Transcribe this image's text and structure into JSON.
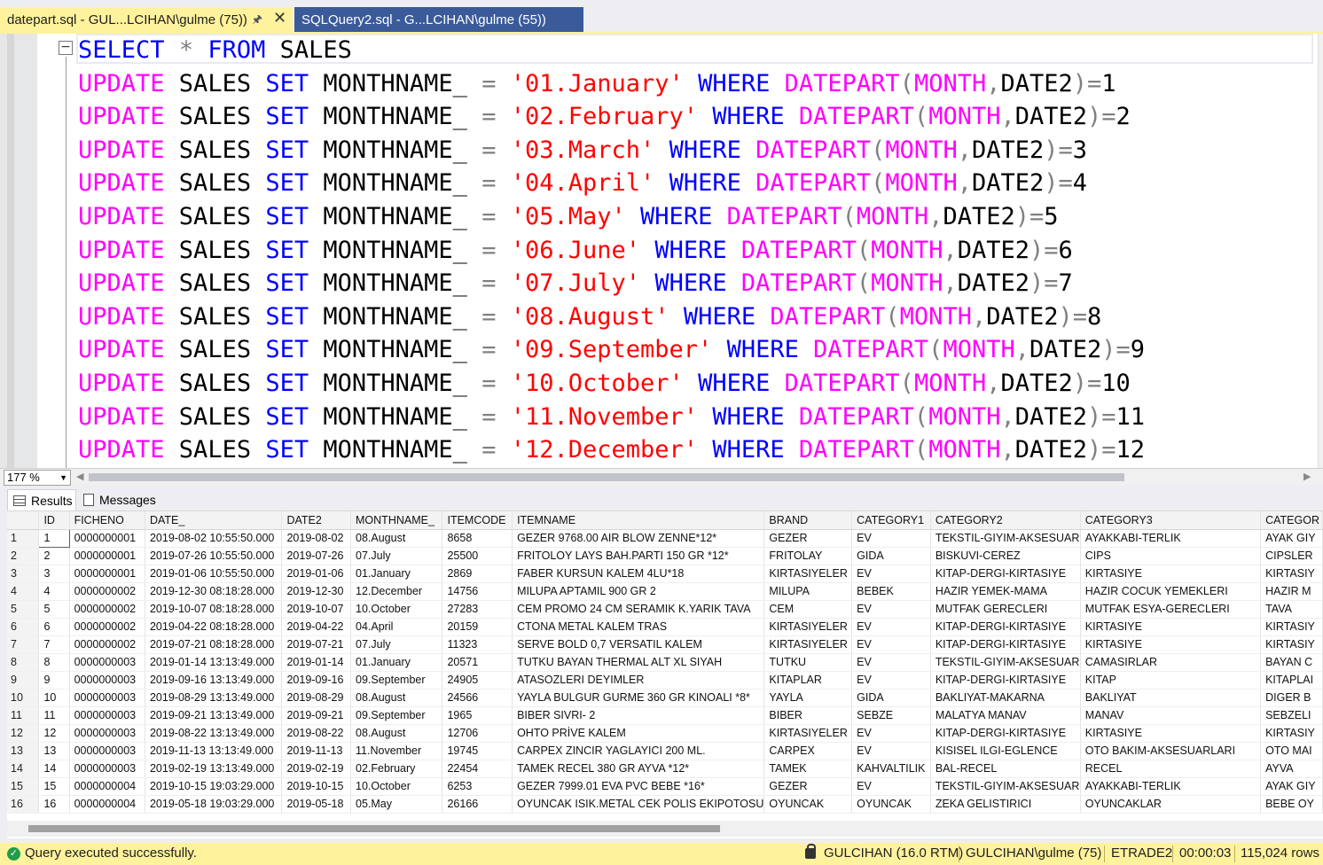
{
  "tabs": {
    "active_label": "datepart.sql - GUL...LCIHAN\\gulme (75))",
    "inactive_label": "SQLQuery2.sql - G...LCIHAN\\gulme (55))"
  },
  "editor": {
    "lines": [
      [
        {
          "t": "SELECT",
          "c": "kw"
        },
        {
          "t": " ",
          "c": "id"
        },
        {
          "t": "*",
          "c": "op"
        },
        {
          "t": " ",
          "c": "id"
        },
        {
          "t": "FROM",
          "c": "kw"
        },
        {
          "t": " SALES",
          "c": "id"
        }
      ],
      [
        {
          "t": "UPDATE",
          "c": "fn"
        },
        {
          "t": " SALES ",
          "c": "id"
        },
        {
          "t": "SET",
          "c": "kw"
        },
        {
          "t": " MONTHNAME_ ",
          "c": "id"
        },
        {
          "t": "=",
          "c": "op"
        },
        {
          "t": " ",
          "c": "id"
        },
        {
          "t": "'01.January'",
          "c": "str"
        },
        {
          "t": " ",
          "c": "id"
        },
        {
          "t": "WHERE",
          "c": "kw"
        },
        {
          "t": " ",
          "c": "id"
        },
        {
          "t": "DATEPART",
          "c": "fn"
        },
        {
          "t": "(",
          "c": "op"
        },
        {
          "t": "MONTH",
          "c": "fn"
        },
        {
          "t": ",",
          "c": "op"
        },
        {
          "t": "DATE2",
          "c": "id"
        },
        {
          "t": ")",
          "c": "op"
        },
        {
          "t": "=",
          "c": "op"
        },
        {
          "t": "1",
          "c": "id"
        }
      ],
      [
        {
          "t": "UPDATE",
          "c": "fn"
        },
        {
          "t": " SALES ",
          "c": "id"
        },
        {
          "t": "SET",
          "c": "kw"
        },
        {
          "t": " MONTHNAME_ ",
          "c": "id"
        },
        {
          "t": "=",
          "c": "op"
        },
        {
          "t": " ",
          "c": "id"
        },
        {
          "t": "'02.February'",
          "c": "str"
        },
        {
          "t": " ",
          "c": "id"
        },
        {
          "t": "WHERE",
          "c": "kw"
        },
        {
          "t": " ",
          "c": "id"
        },
        {
          "t": "DATEPART",
          "c": "fn"
        },
        {
          "t": "(",
          "c": "op"
        },
        {
          "t": "MONTH",
          "c": "fn"
        },
        {
          "t": ",",
          "c": "op"
        },
        {
          "t": "DATE2",
          "c": "id"
        },
        {
          "t": ")",
          "c": "op"
        },
        {
          "t": "=",
          "c": "op"
        },
        {
          "t": "2",
          "c": "id"
        }
      ],
      [
        {
          "t": "UPDATE",
          "c": "fn"
        },
        {
          "t": " SALES ",
          "c": "id"
        },
        {
          "t": "SET",
          "c": "kw"
        },
        {
          "t": " MONTHNAME_ ",
          "c": "id"
        },
        {
          "t": "=",
          "c": "op"
        },
        {
          "t": " ",
          "c": "id"
        },
        {
          "t": "'03.March'",
          "c": "str"
        },
        {
          "t": " ",
          "c": "id"
        },
        {
          "t": "WHERE",
          "c": "kw"
        },
        {
          "t": " ",
          "c": "id"
        },
        {
          "t": "DATEPART",
          "c": "fn"
        },
        {
          "t": "(",
          "c": "op"
        },
        {
          "t": "MONTH",
          "c": "fn"
        },
        {
          "t": ",",
          "c": "op"
        },
        {
          "t": "DATE2",
          "c": "id"
        },
        {
          "t": ")",
          "c": "op"
        },
        {
          "t": "=",
          "c": "op"
        },
        {
          "t": "3",
          "c": "id"
        }
      ],
      [
        {
          "t": "UPDATE",
          "c": "fn"
        },
        {
          "t": " SALES ",
          "c": "id"
        },
        {
          "t": "SET",
          "c": "kw"
        },
        {
          "t": " MONTHNAME_ ",
          "c": "id"
        },
        {
          "t": "=",
          "c": "op"
        },
        {
          "t": " ",
          "c": "id"
        },
        {
          "t": "'04.April'",
          "c": "str"
        },
        {
          "t": " ",
          "c": "id"
        },
        {
          "t": "WHERE",
          "c": "kw"
        },
        {
          "t": " ",
          "c": "id"
        },
        {
          "t": "DATEPART",
          "c": "fn"
        },
        {
          "t": "(",
          "c": "op"
        },
        {
          "t": "MONTH",
          "c": "fn"
        },
        {
          "t": ",",
          "c": "op"
        },
        {
          "t": "DATE2",
          "c": "id"
        },
        {
          "t": ")",
          "c": "op"
        },
        {
          "t": "=",
          "c": "op"
        },
        {
          "t": "4",
          "c": "id"
        }
      ],
      [
        {
          "t": "UPDATE",
          "c": "fn"
        },
        {
          "t": " SALES ",
          "c": "id"
        },
        {
          "t": "SET",
          "c": "kw"
        },
        {
          "t": " MONTHNAME_ ",
          "c": "id"
        },
        {
          "t": "=",
          "c": "op"
        },
        {
          "t": " ",
          "c": "id"
        },
        {
          "t": "'05.May'",
          "c": "str"
        },
        {
          "t": " ",
          "c": "id"
        },
        {
          "t": "WHERE",
          "c": "kw"
        },
        {
          "t": " ",
          "c": "id"
        },
        {
          "t": "DATEPART",
          "c": "fn"
        },
        {
          "t": "(",
          "c": "op"
        },
        {
          "t": "MONTH",
          "c": "fn"
        },
        {
          "t": ",",
          "c": "op"
        },
        {
          "t": "DATE2",
          "c": "id"
        },
        {
          "t": ")",
          "c": "op"
        },
        {
          "t": "=",
          "c": "op"
        },
        {
          "t": "5",
          "c": "id"
        }
      ],
      [
        {
          "t": "UPDATE",
          "c": "fn"
        },
        {
          "t": " SALES ",
          "c": "id"
        },
        {
          "t": "SET",
          "c": "kw"
        },
        {
          "t": " MONTHNAME_ ",
          "c": "id"
        },
        {
          "t": "=",
          "c": "op"
        },
        {
          "t": " ",
          "c": "id"
        },
        {
          "t": "'06.June'",
          "c": "str"
        },
        {
          "t": " ",
          "c": "id"
        },
        {
          "t": "WHERE",
          "c": "kw"
        },
        {
          "t": " ",
          "c": "id"
        },
        {
          "t": "DATEPART",
          "c": "fn"
        },
        {
          "t": "(",
          "c": "op"
        },
        {
          "t": "MONTH",
          "c": "fn"
        },
        {
          "t": ",",
          "c": "op"
        },
        {
          "t": "DATE2",
          "c": "id"
        },
        {
          "t": ")",
          "c": "op"
        },
        {
          "t": "=",
          "c": "op"
        },
        {
          "t": "6",
          "c": "id"
        }
      ],
      [
        {
          "t": "UPDATE",
          "c": "fn"
        },
        {
          "t": " SALES ",
          "c": "id"
        },
        {
          "t": "SET",
          "c": "kw"
        },
        {
          "t": " MONTHNAME_ ",
          "c": "id"
        },
        {
          "t": "=",
          "c": "op"
        },
        {
          "t": " ",
          "c": "id"
        },
        {
          "t": "'07.July'",
          "c": "str"
        },
        {
          "t": " ",
          "c": "id"
        },
        {
          "t": "WHERE",
          "c": "kw"
        },
        {
          "t": " ",
          "c": "id"
        },
        {
          "t": "DATEPART",
          "c": "fn"
        },
        {
          "t": "(",
          "c": "op"
        },
        {
          "t": "MONTH",
          "c": "fn"
        },
        {
          "t": ",",
          "c": "op"
        },
        {
          "t": "DATE2",
          "c": "id"
        },
        {
          "t": ")",
          "c": "op"
        },
        {
          "t": "=",
          "c": "op"
        },
        {
          "t": "7",
          "c": "id"
        }
      ],
      [
        {
          "t": "UPDATE",
          "c": "fn"
        },
        {
          "t": " SALES ",
          "c": "id"
        },
        {
          "t": "SET",
          "c": "kw"
        },
        {
          "t": " MONTHNAME_ ",
          "c": "id"
        },
        {
          "t": "=",
          "c": "op"
        },
        {
          "t": " ",
          "c": "id"
        },
        {
          "t": "'08.August'",
          "c": "str"
        },
        {
          "t": " ",
          "c": "id"
        },
        {
          "t": "WHERE",
          "c": "kw"
        },
        {
          "t": " ",
          "c": "id"
        },
        {
          "t": "DATEPART",
          "c": "fn"
        },
        {
          "t": "(",
          "c": "op"
        },
        {
          "t": "MONTH",
          "c": "fn"
        },
        {
          "t": ",",
          "c": "op"
        },
        {
          "t": "DATE2",
          "c": "id"
        },
        {
          "t": ")",
          "c": "op"
        },
        {
          "t": "=",
          "c": "op"
        },
        {
          "t": "8",
          "c": "id"
        }
      ],
      [
        {
          "t": "UPDATE",
          "c": "fn"
        },
        {
          "t": " SALES ",
          "c": "id"
        },
        {
          "t": "SET",
          "c": "kw"
        },
        {
          "t": " MONTHNAME_ ",
          "c": "id"
        },
        {
          "t": "=",
          "c": "op"
        },
        {
          "t": " ",
          "c": "id"
        },
        {
          "t": "'09.September'",
          "c": "str"
        },
        {
          "t": " ",
          "c": "id"
        },
        {
          "t": "WHERE",
          "c": "kw"
        },
        {
          "t": " ",
          "c": "id"
        },
        {
          "t": "DATEPART",
          "c": "fn"
        },
        {
          "t": "(",
          "c": "op"
        },
        {
          "t": "MONTH",
          "c": "fn"
        },
        {
          "t": ",",
          "c": "op"
        },
        {
          "t": "DATE2",
          "c": "id"
        },
        {
          "t": ")",
          "c": "op"
        },
        {
          "t": "=",
          "c": "op"
        },
        {
          "t": "9",
          "c": "id"
        }
      ],
      [
        {
          "t": "UPDATE",
          "c": "fn"
        },
        {
          "t": " SALES ",
          "c": "id"
        },
        {
          "t": "SET",
          "c": "kw"
        },
        {
          "t": " MONTHNAME_ ",
          "c": "id"
        },
        {
          "t": "=",
          "c": "op"
        },
        {
          "t": " ",
          "c": "id"
        },
        {
          "t": "'10.October'",
          "c": "str"
        },
        {
          "t": " ",
          "c": "id"
        },
        {
          "t": "WHERE",
          "c": "kw"
        },
        {
          "t": " ",
          "c": "id"
        },
        {
          "t": "DATEPART",
          "c": "fn"
        },
        {
          "t": "(",
          "c": "op"
        },
        {
          "t": "MONTH",
          "c": "fn"
        },
        {
          "t": ",",
          "c": "op"
        },
        {
          "t": "DATE2",
          "c": "id"
        },
        {
          "t": ")",
          "c": "op"
        },
        {
          "t": "=",
          "c": "op"
        },
        {
          "t": "10",
          "c": "id"
        }
      ],
      [
        {
          "t": "UPDATE",
          "c": "fn"
        },
        {
          "t": " SALES ",
          "c": "id"
        },
        {
          "t": "SET",
          "c": "kw"
        },
        {
          "t": " MONTHNAME_ ",
          "c": "id"
        },
        {
          "t": "=",
          "c": "op"
        },
        {
          "t": " ",
          "c": "id"
        },
        {
          "t": "'11.November'",
          "c": "str"
        },
        {
          "t": " ",
          "c": "id"
        },
        {
          "t": "WHERE",
          "c": "kw"
        },
        {
          "t": " ",
          "c": "id"
        },
        {
          "t": "DATEPART",
          "c": "fn"
        },
        {
          "t": "(",
          "c": "op"
        },
        {
          "t": "MONTH",
          "c": "fn"
        },
        {
          "t": ",",
          "c": "op"
        },
        {
          "t": "DATE2",
          "c": "id"
        },
        {
          "t": ")",
          "c": "op"
        },
        {
          "t": "=",
          "c": "op"
        },
        {
          "t": "11",
          "c": "id"
        }
      ],
      [
        {
          "t": "UPDATE",
          "c": "fn"
        },
        {
          "t": " SALES ",
          "c": "id"
        },
        {
          "t": "SET",
          "c": "kw"
        },
        {
          "t": " MONTHNAME_ ",
          "c": "id"
        },
        {
          "t": "=",
          "c": "op"
        },
        {
          "t": " ",
          "c": "id"
        },
        {
          "t": "'12.December'",
          "c": "str"
        },
        {
          "t": " ",
          "c": "id"
        },
        {
          "t": "WHERE",
          "c": "kw"
        },
        {
          "t": " ",
          "c": "id"
        },
        {
          "t": "DATEPART",
          "c": "fn"
        },
        {
          "t": "(",
          "c": "op"
        },
        {
          "t": "MONTH",
          "c": "fn"
        },
        {
          "t": ",",
          "c": "op"
        },
        {
          "t": "DATE2",
          "c": "id"
        },
        {
          "t": ")",
          "c": "op"
        },
        {
          "t": "=",
          "c": "op"
        },
        {
          "t": "12",
          "c": "id"
        }
      ]
    ]
  },
  "zoom": {
    "value": "177 %"
  },
  "results_tabs": {
    "results": "Results",
    "messages": "Messages"
  },
  "grid": {
    "columns": [
      "ID",
      "FICHENO",
      "DATE_",
      "DATE2",
      "MONTHNAME_",
      "ITEMCODE",
      "ITEMNAME",
      "BRAND",
      "CATEGORY1",
      "CATEGORY2",
      "CATEGORY3",
      "CATEGOR"
    ],
    "rows": [
      [
        "1",
        "0000000001",
        "2019-08-02 10:55:50.000",
        "2019-08-02",
        "08.August",
        "8658",
        "GEZER 9768.00 AIR BLOW ZENNE*12*",
        "GEZER",
        "EV",
        "TEKSTIL-GIYIM-AKSESUAR",
        "AYAKKABI-TERLIK",
        "AYAK GIY"
      ],
      [
        "2",
        "0000000001",
        "2019-07-26 10:55:50.000",
        "2019-07-26",
        "07.July",
        "25500",
        "FRITOLOY LAYS BAH.PARTI 150 GR *12*",
        "FRITOLAY",
        "GIDA",
        "BISKUVI-CEREZ",
        "CIPS",
        "CIPSLER"
      ],
      [
        "3",
        "0000000001",
        "2019-01-06 10:55:50.000",
        "2019-01-06",
        "01.January",
        "2869",
        "FABER KURSUN KALEM 4LU*18",
        "KIRTASIYELER",
        "EV",
        "KITAP-DERGI-KIRTASIYE",
        "KIRTASIYE",
        "KIRTASIY"
      ],
      [
        "4",
        "0000000002",
        "2019-12-30 08:18:28.000",
        "2019-12-30",
        "12.December",
        "14756",
        "MILUPA APTAMIL 900 GR 2",
        "MILUPA",
        "BEBEK",
        "HAZIR YEMEK-MAMA",
        "HAZIR COCUK YEMEKLERI",
        "HAZIR M"
      ],
      [
        "5",
        "0000000002",
        "2019-10-07 08:18:28.000",
        "2019-10-07",
        "10.October",
        "27283",
        "CEM PROMO 24 CM SERAMIK K.YARIK TAVA",
        "CEM",
        "EV",
        "MUTFAK GERECLERI",
        "MUTFAK ESYA-GERECLERI",
        "TAVA"
      ],
      [
        "6",
        "0000000002",
        "2019-04-22 08:18:28.000",
        "2019-04-22",
        "04.April",
        "20159",
        "CTONA METAL KALEM TRAS",
        "KIRTASIYELER",
        "EV",
        "KITAP-DERGI-KIRTASIYE",
        "KIRTASIYE",
        "KIRTASIY"
      ],
      [
        "7",
        "0000000002",
        "2019-07-21 08:18:28.000",
        "2019-07-21",
        "07.July",
        "11323",
        "SERVE BOLD 0,7 VERSATIL KALEM",
        "KIRTASIYELER",
        "EV",
        "KITAP-DERGI-KIRTASIYE",
        "KIRTASIYE",
        "KIRTASIY"
      ],
      [
        "8",
        "0000000003",
        "2019-01-14 13:13:49.000",
        "2019-01-14",
        "01.January",
        "20571",
        "TUTKU BAYAN THERMAL ALT XL SIYAH",
        "TUTKU",
        "EV",
        "TEKSTIL-GIYIM-AKSESUAR",
        "CAMASIRLAR",
        "BAYAN C"
      ],
      [
        "9",
        "0000000003",
        "2019-09-16 13:13:49.000",
        "2019-09-16",
        "09.September",
        "24905",
        "ATASOZLERI DEYIMLER",
        "KITAPLAR",
        "EV",
        "KITAP-DERGI-KIRTASIYE",
        "KITAP",
        "KITAPLAI"
      ],
      [
        "10",
        "0000000003",
        "2019-08-29 13:13:49.000",
        "2019-08-29",
        "08.August",
        "24566",
        "YAYLA BULGUR GURME 360 GR KINOALI *8*",
        "YAYLA",
        "GIDA",
        "BAKLIYAT-MAKARNA",
        "BAKLIYAT",
        "DIGER B"
      ],
      [
        "11",
        "0000000003",
        "2019-09-21 13:13:49.000",
        "2019-09-21",
        "09.September",
        "1965",
        "BIBER SIVRI- 2",
        "BIBER",
        "SEBZE",
        "MALATYA MANAV",
        "MANAV",
        "SEBZELI"
      ],
      [
        "12",
        "0000000003",
        "2019-08-22 13:13:49.000",
        "2019-08-22",
        "08.August",
        "12706",
        "OHTO PRİVE KALEM",
        "KIRTASIYELER",
        "EV",
        "KITAP-DERGI-KIRTASIYE",
        "KIRTASIYE",
        "KIRTASIY"
      ],
      [
        "13",
        "0000000003",
        "2019-11-13 13:13:49.000",
        "2019-11-13",
        "11.November",
        "19745",
        "CARPEX ZINCIR YAGLAYICI 200 ML.",
        "CARPEX",
        "EV",
        "KISISEL ILGI-EGLENCE",
        "OTO BAKIM-AKSESUARLARI",
        "OTO MAI"
      ],
      [
        "14",
        "0000000003",
        "2019-02-19 13:13:49.000",
        "2019-02-19",
        "02.February",
        "22454",
        "TAMEK RECEL 380 GR AYVA *12*",
        "TAMEK",
        "KAHVALTILIK",
        "BAL-RECEL",
        "RECEL",
        "AYVA"
      ],
      [
        "15",
        "0000000004",
        "2019-10-15 19:03:29.000",
        "2019-10-15",
        "10.October",
        "6253",
        "GEZER 7999.01 EVA PVC BEBE *16*",
        "GEZER",
        "EV",
        "TEKSTIL-GIYIM-AKSESUAR",
        "AYAKKABI-TERLIK",
        "AYAK GIY"
      ],
      [
        "16",
        "0000000004",
        "2019-05-18 19:03:29.000",
        "2019-05-18",
        "05.May",
        "26166",
        "OYUNCAK ISIK.METAL CEK POLIS EKIPOTOSU",
        "OYUNCAK",
        "OYUNCAK",
        "ZEKA GELISTIRICI",
        "OYUNCAKLAR",
        "BEBE OY"
      ]
    ]
  },
  "status": {
    "message": "Query executed successfully.",
    "server": "GULCIHAN (16.0 RTM)",
    "user": "GULCIHAN\\gulme (75)",
    "database": "ETRADE2",
    "elapsed": "00:00:03",
    "rows": "115,024 rows",
    "accent": "#fff29d"
  }
}
